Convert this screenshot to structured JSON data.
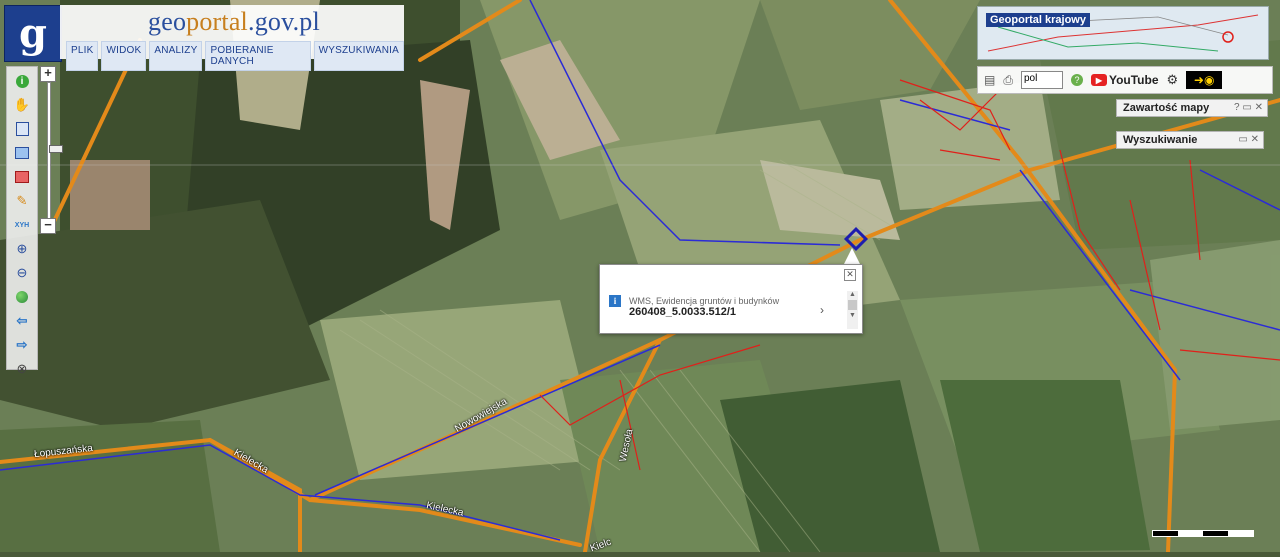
{
  "header": {
    "site_prefix": "geo",
    "site_emphasis": "portal",
    "site_suffix": ".gov.pl",
    "logo_glyph": "g",
    "menu": [
      "PLIK",
      "WIDOK",
      "ANALIZY",
      "POBIERANIE DANYCH",
      "WYSZUKIWANIA"
    ]
  },
  "overview": {
    "title": "Geoportal krajowy"
  },
  "top_controls": {
    "language": "pol",
    "youtube": "YouTube"
  },
  "panels": {
    "map_contents": "Zawartość mapy",
    "search": "Wyszukiwanie",
    "panel_buttons": "? ▭ ✕"
  },
  "popup": {
    "layer": "WMS, Ewidencja gruntów i budynków",
    "value": "260408_5.0033.512/1"
  },
  "roads": {
    "lopuszanska": "Łopuszańska",
    "kielecka_1": "Kielecka",
    "kielecka_2": "Kielecka",
    "nowowiejska": "Nowowiejska",
    "wesola": "Wesoła",
    "kielc": "Kielc"
  },
  "toolbar_icons": [
    "info-icon",
    "pan-hand-icon",
    "layers-icon",
    "add-layer-icon",
    "remove-layer-icon",
    "pencil-icon",
    "xyz-icon",
    "zoom-in-icon",
    "zoom-out-icon",
    "globe-icon",
    "back-arrow-icon",
    "forward-arrow-icon",
    "measure-icon"
  ],
  "colors": {
    "accent": "#1d3f8e",
    "orange_road": "#e38a1a",
    "parcel_red": "#e0201a",
    "parcel_blue": "#2b2bd6"
  }
}
